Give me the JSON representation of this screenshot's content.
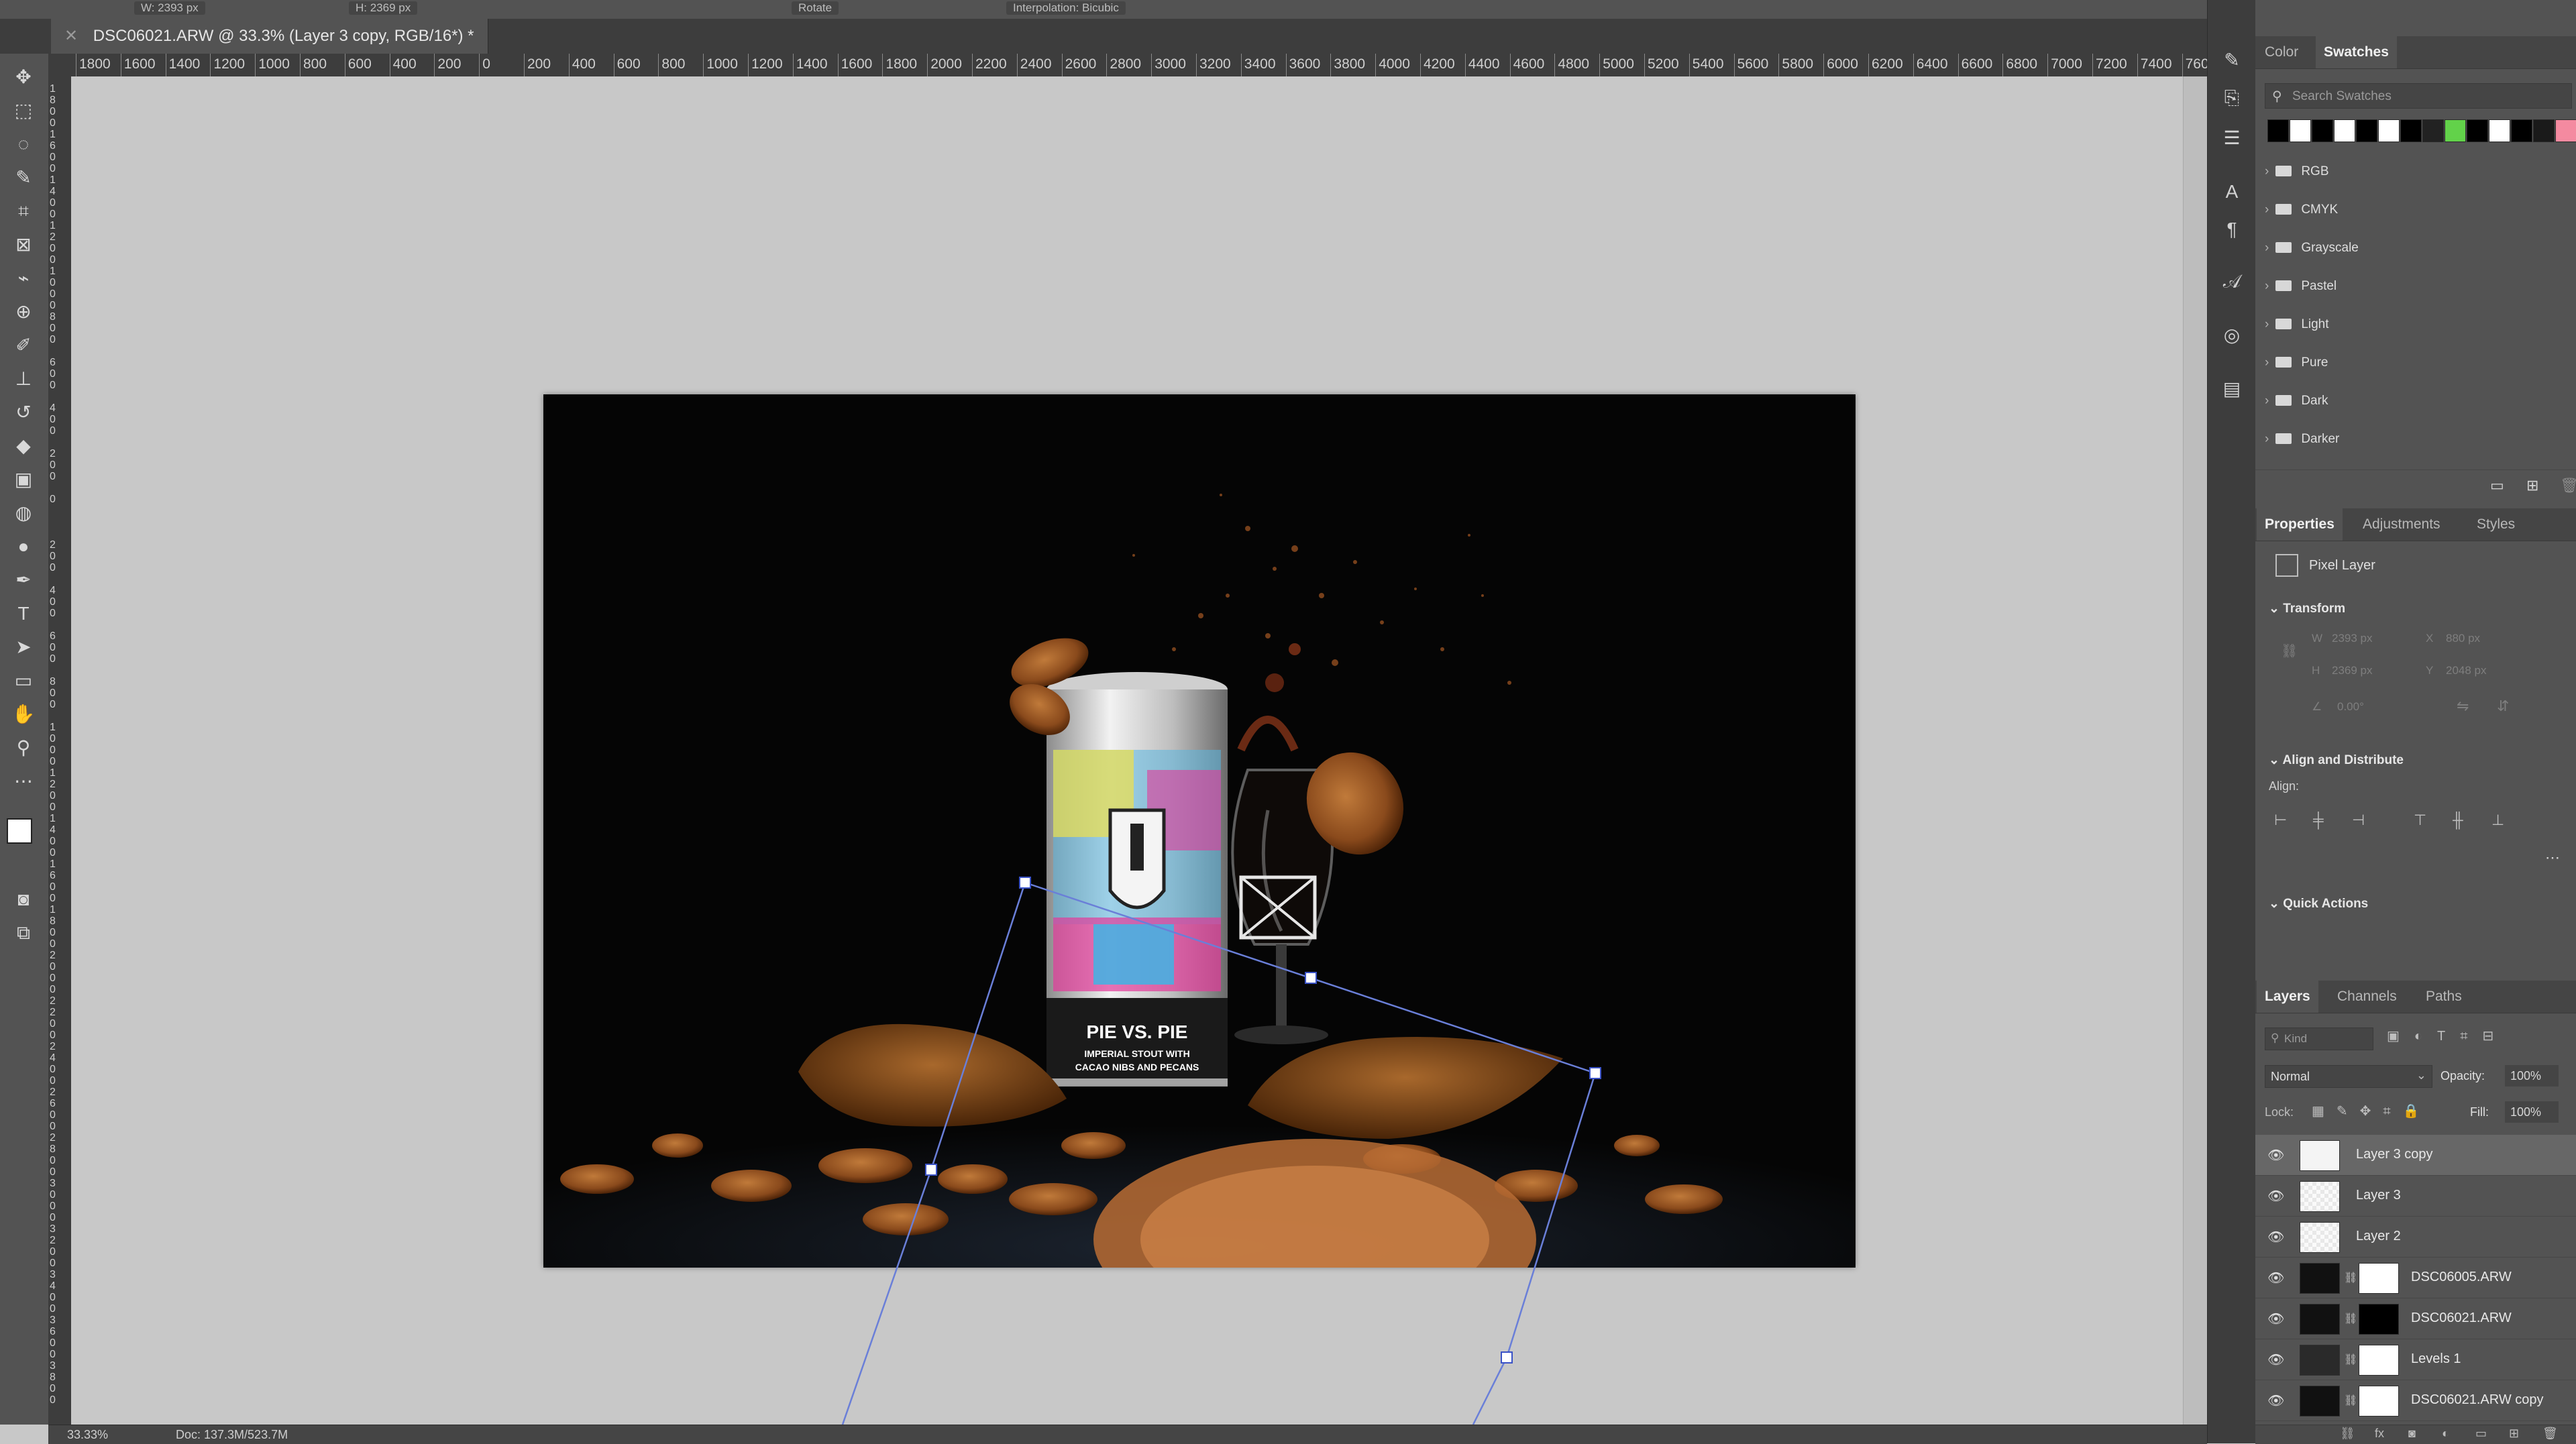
{
  "document": {
    "tab_title": "DSC06021.ARW @ 33.3% (Layer 3 copy, RGB/16*) *",
    "zoom": "33.33%",
    "doc_size": "Doc: 137.3M/523.7M"
  },
  "options_bar": {
    "items": [
      "W: 2393 px",
      "H: 2369 px",
      "Rotate",
      "Interpolation: Bicubic"
    ]
  },
  "rulers": {
    "horizontal": [
      "1800",
      "1600",
      "1400",
      "1200",
      "1000",
      "800",
      "600",
      "400",
      "200",
      "0",
      "200",
      "400",
      "600",
      "800",
      "1000",
      "1200",
      "1400",
      "1600",
      "1800",
      "2000",
      "2200",
      "2400",
      "2600",
      "2800",
      "3000",
      "3200",
      "3400",
      "3600",
      "3800",
      "4000",
      "4200",
      "4400",
      "4600",
      "4800",
      "5000",
      "5200",
      "5400",
      "5600",
      "5800",
      "6000",
      "6200",
      "6400",
      "6600",
      "6800",
      "7000",
      "7200",
      "7400",
      "7600"
    ],
    "vertical": [
      "1800",
      "1600",
      "1400",
      "1200",
      "1000",
      "800",
      "600",
      "400",
      "200",
      "0",
      "200",
      "400",
      "600",
      "800",
      "1000",
      "1200",
      "1400",
      "1600",
      "1800",
      "2000",
      "2200",
      "2400",
      "2600",
      "2800",
      "3000",
      "3200",
      "3400",
      "3600",
      "3800"
    ]
  },
  "photo": {
    "can_title": "PIE VS. PIE",
    "can_subtitle": "IMPERIAL STOUT WITH",
    "can_subtitle2": "CACAO NIBS AND PECANS"
  },
  "swatches_panel": {
    "tabs": [
      "Color",
      "Swatches"
    ],
    "active_tab": "Swatches",
    "search_placeholder": "Search Swatches",
    "recent_colors": [
      "#000000",
      "#ffffff",
      "#000000",
      "#ffffff",
      "#000000",
      "#ffffff",
      "#000000",
      "#222222",
      "#62d24a",
      "#000000",
      "#ffffff",
      "#000000",
      "#1a1a1a",
      "#f48aa0"
    ],
    "folders": [
      "RGB",
      "CMYK",
      "Grayscale",
      "Pastel",
      "Light",
      "Pure",
      "Dark",
      "Darker"
    ]
  },
  "properties_panel": {
    "tabs": [
      "Properties",
      "Adjustments",
      "Styles"
    ],
    "active_tab": "Properties",
    "layer_type": "Pixel Layer",
    "transform_label": "Transform",
    "w": "2393 px",
    "x": "880 px",
    "h": "2369 px",
    "y": "2048 px",
    "angle": "0.00°",
    "align_distribute_label": "Align and Distribute",
    "align_label": "Align:",
    "quick_actions_label": "Quick Actions"
  },
  "layers_panel": {
    "tabs": [
      "Layers",
      "Channels",
      "Paths"
    ],
    "active_tab": "Layers",
    "kind_placeholder": "Kind",
    "blend_mode": "Normal",
    "opacity_label": "Opacity:",
    "opacity": "100%",
    "lock_label": "Lock:",
    "fill_label": "Fill:",
    "fill": "100%",
    "layers": [
      {
        "name": "Layer 3 copy",
        "selected": true
      },
      {
        "name": "Layer 3",
        "selected": false
      },
      {
        "name": "Layer 2",
        "selected": false
      },
      {
        "name": "DSC06005.ARW",
        "selected": false
      },
      {
        "name": "DSC06021.ARW",
        "selected": false
      },
      {
        "name": "Levels 1",
        "selected": false
      },
      {
        "name": "DSC06021.ARW copy",
        "selected": false
      }
    ]
  }
}
